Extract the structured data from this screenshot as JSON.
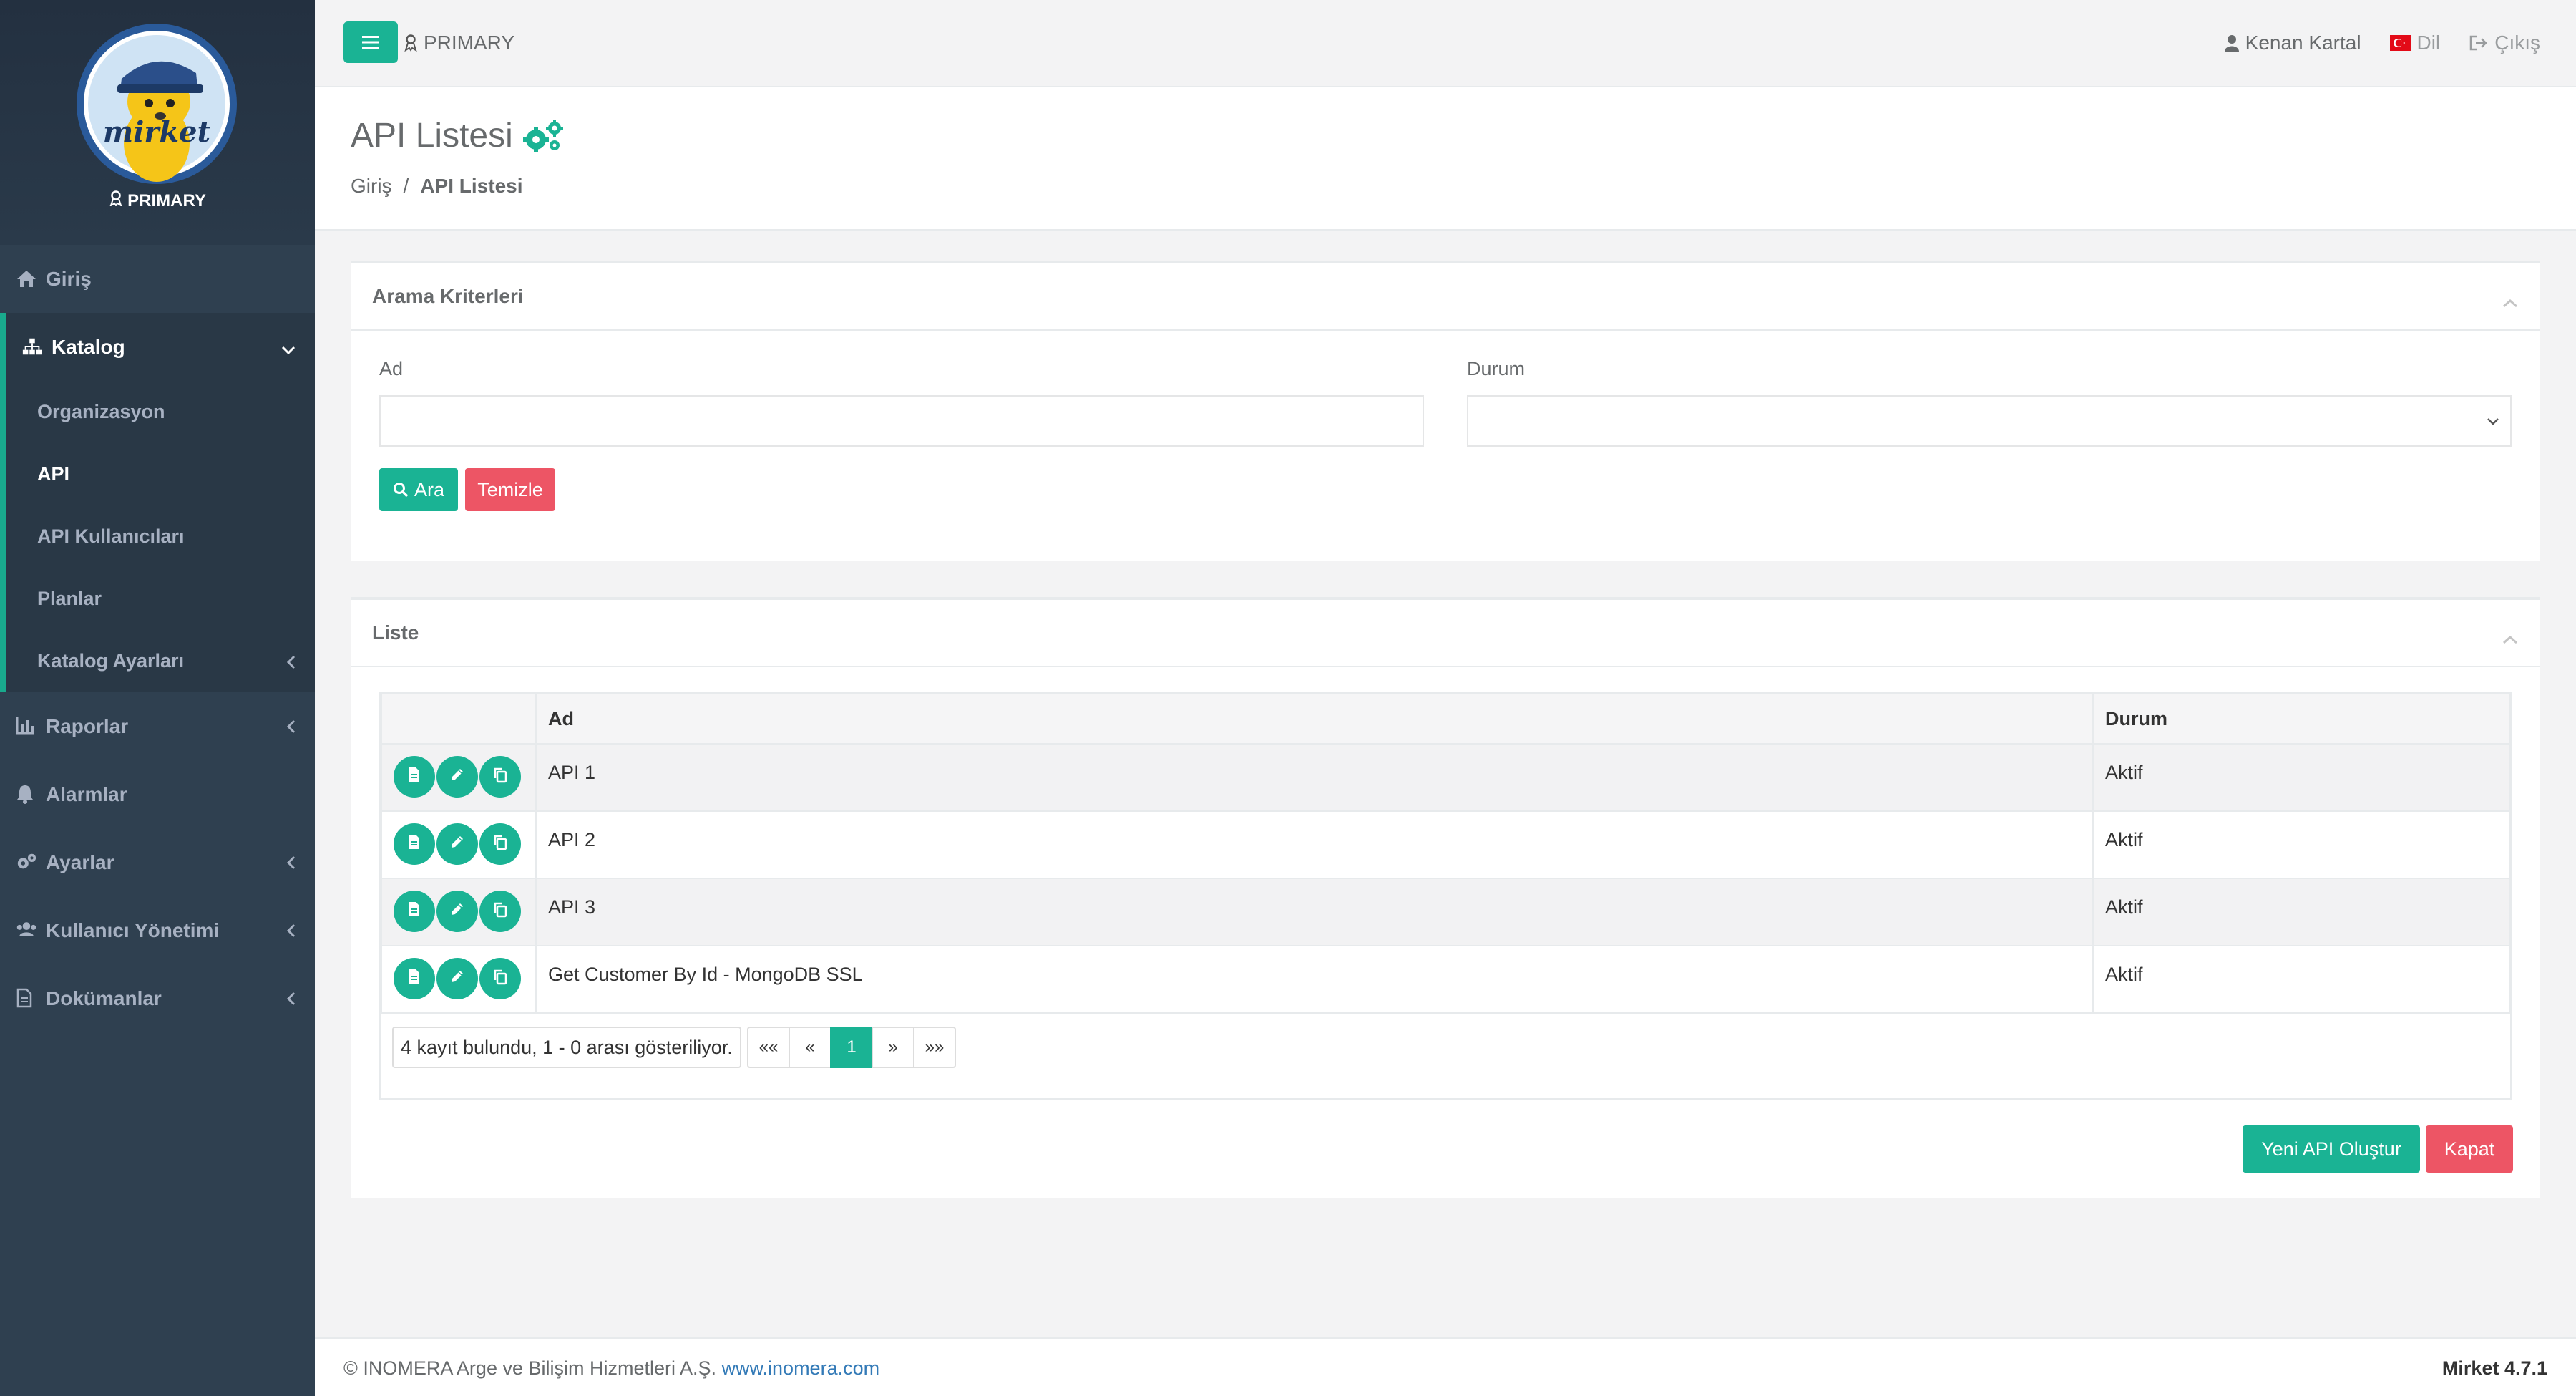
{
  "sidebar": {
    "org_label": "PRIMARY",
    "logo_text": "mirket",
    "items": [
      {
        "label": "Giriş",
        "icon": "home-icon"
      },
      {
        "label": "Katalog",
        "icon": "sitemap-icon"
      },
      {
        "label": "Raporlar",
        "icon": "bar-chart-icon"
      },
      {
        "label": "Alarmlar",
        "icon": "bell-icon"
      },
      {
        "label": "Ayarlar",
        "icon": "gears-icon"
      },
      {
        "label": "Kullanıcı Yönetimi",
        "icon": "users-icon"
      },
      {
        "label": "Dokümanlar",
        "icon": "document-icon"
      }
    ],
    "catalog_sub": [
      {
        "label": "Organizasyon"
      },
      {
        "label": "API"
      },
      {
        "label": "API Kullanıcıları"
      },
      {
        "label": "Planlar"
      },
      {
        "label": "Katalog Ayarları"
      }
    ]
  },
  "topbar": {
    "org_label": "PRIMARY",
    "user_name": "Kenan Kartal",
    "language_label": "Dil",
    "logout_label": "Çıkış"
  },
  "page": {
    "title": "API Listesi",
    "breadcrumb_home": "Giriş",
    "breadcrumb_separator": "/",
    "breadcrumb_current": "API Listesi"
  },
  "search": {
    "panel_title": "Arama Kriterleri",
    "name_label": "Ad",
    "name_value": "",
    "status_label": "Durum",
    "status_value": "",
    "search_button": "Ara",
    "clear_button": "Temizle"
  },
  "list": {
    "panel_title": "Liste",
    "columns": {
      "name": "Ad",
      "status": "Durum"
    },
    "rows": [
      {
        "name": "API 1",
        "status": "Aktif"
      },
      {
        "name": "API 2",
        "status": "Aktif"
      },
      {
        "name": "API 3",
        "status": "Aktif"
      },
      {
        "name": "Get Customer By Id - MongoDB SSL",
        "status": "Aktif"
      }
    ],
    "record_info": "4 kayıt bulundu, 1 - 0 arası gösteriliyor.",
    "pager": {
      "first": "««",
      "prev": "«",
      "current": "1",
      "next": "»",
      "last": "»»"
    },
    "create_button": "Yeni API Oluştur",
    "close_button": "Kapat"
  },
  "footer": {
    "copyright": "© INOMERA Arge ve Bilişim Hizmetleri A.Ş.",
    "link_text": "www.inomera.com",
    "version": "Mirket 4.7.1"
  },
  "colors": {
    "primary": "#1ab394",
    "danger": "#ed5565",
    "sidebar": "#2f4050",
    "link": "#337ab7"
  }
}
